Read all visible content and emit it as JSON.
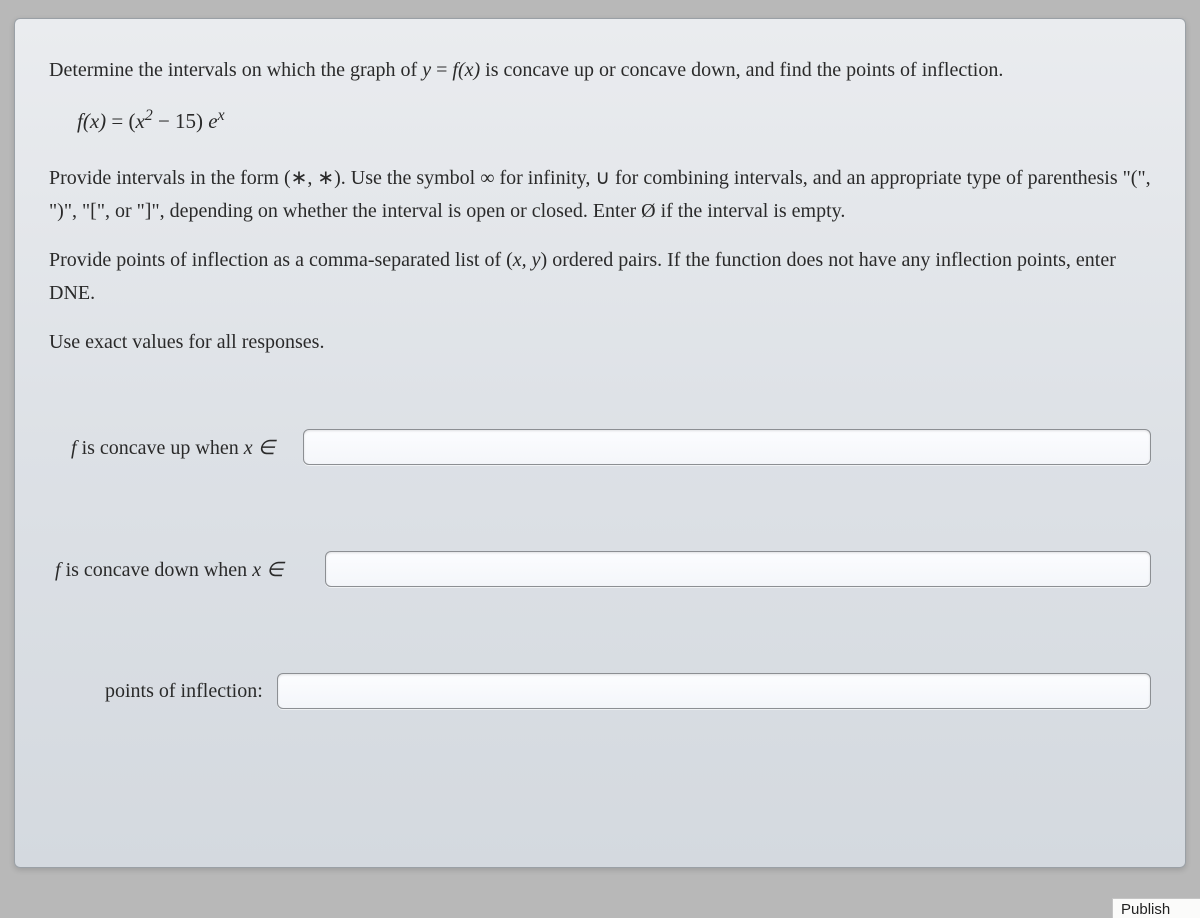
{
  "question": {
    "prompt_prefix": "Determine the intervals on which the graph of ",
    "prompt_eq_lhs": "y",
    "prompt_eq_eq": " = ",
    "prompt_eq_rhs": "f(x)",
    "prompt_suffix": " is concave up or concave down, and find the points of inflection.",
    "function_lhs": "f(x)",
    "function_eq": " = ",
    "function_open": "(",
    "function_term1_base": "x",
    "function_term1_exp": "2",
    "function_minus": " − 15",
    "function_close": ") ",
    "function_e": "e",
    "function_e_exp": "x"
  },
  "instructions": {
    "p1": "Provide intervals in the form (∗, ∗). Use the symbol ∞ for infinity, ∪ for combining intervals, and an appropriate type of parenthesis \"(\", \")\", \"[\", or \"]\", depending on whether the interval is open or closed. Enter Ø if the interval is empty.",
    "p2_prefix": "Provide points of inflection as a comma-separated list of (",
    "p2_xy": "x, y",
    "p2_suffix": ") ordered pairs. If the function does not have any inflection points, enter DNE.",
    "p3": "Use exact values for all responses."
  },
  "answers": {
    "concave_up_prefix": " is concave up when ",
    "concave_down_prefix": " is concave down when ",
    "x_in": "x ∈",
    "poi_label": "points of inflection:",
    "f_letter": "f",
    "concave_up_value": "",
    "concave_down_value": "",
    "poi_value": ""
  },
  "footer": {
    "fragment": "Publish"
  }
}
